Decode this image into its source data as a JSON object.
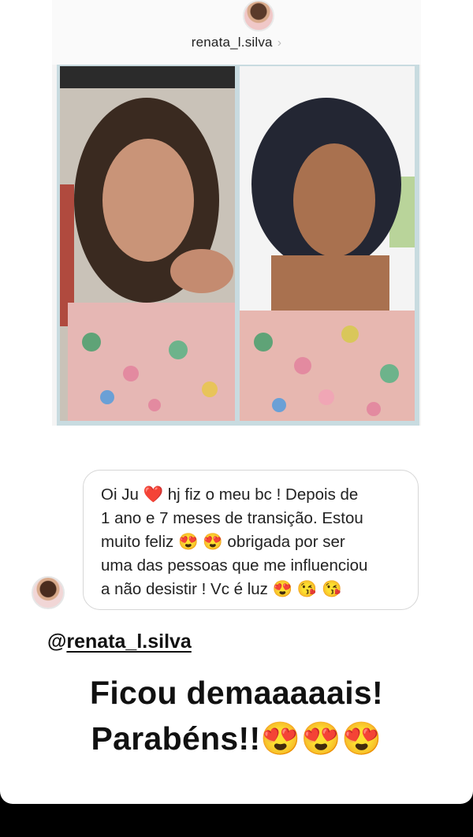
{
  "shared_post": {
    "username": "renata_l.silva",
    "chevron": "›",
    "avatar_icon": "profile-avatar",
    "photos": [
      "before-photo",
      "after-photo"
    ]
  },
  "reply": {
    "text": "Oi Ju ❤️ hj fiz o meu bc ! Depois de\n1 ano e 7 meses de transição.  Estou\nmuito feliz 😍 😍  obrigada por ser\numa das pessoas que me influenciou\na não desistir ! Vc é luz 😍 😘 😘"
  },
  "mention": {
    "at": "@",
    "handle": "renata_l.silva"
  },
  "caption": {
    "line1": "Ficou demaaaaais!",
    "line2": "Parabéns!!😍😍😍"
  },
  "colors": {
    "background": "#000000",
    "card": "#ffffff",
    "bubble_border": "#d6d6d6",
    "text": "#111111"
  }
}
